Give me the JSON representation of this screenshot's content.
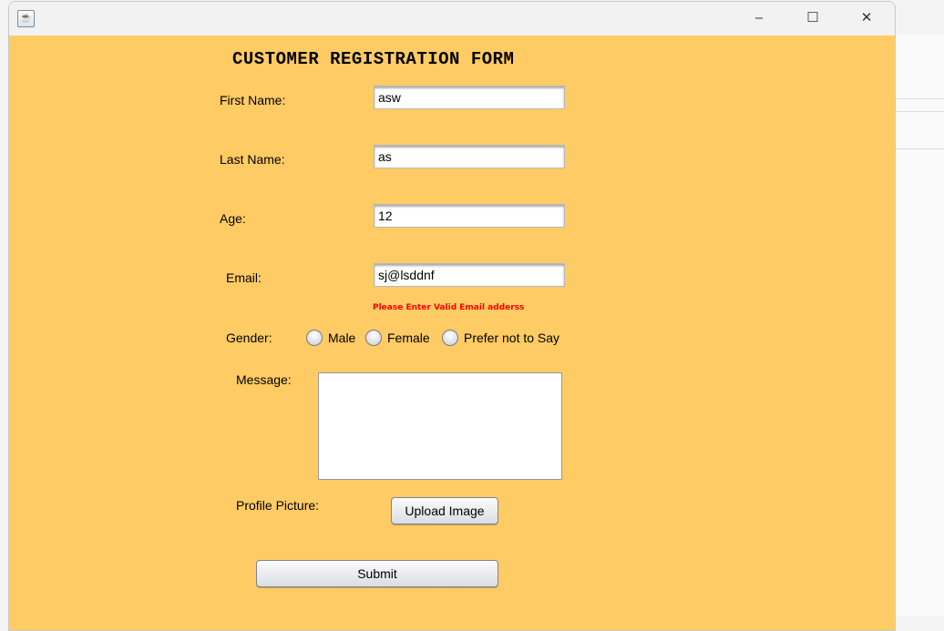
{
  "window": {
    "icon": "java-icon",
    "controls": {
      "minimize": "minimize-icon",
      "maximize": "maximize-icon",
      "close": "close-icon"
    }
  },
  "colors": {
    "background": "#ffcb64",
    "error": "#ff0000"
  },
  "form": {
    "title": "CUSTOMER REGISTRATION FORM",
    "first_name": {
      "label": "First Name:",
      "value": "asw"
    },
    "last_name": {
      "label": "Last Name:",
      "value": "as"
    },
    "age": {
      "label": "Age:",
      "value": "12"
    },
    "email": {
      "label": "Email:",
      "value": "sj@lsddnf",
      "error": "Please Enter Valid Email adderss"
    },
    "gender": {
      "label": "Gender:",
      "options": [
        "Male",
        "Female",
        "Prefer not to Say"
      ],
      "selected": null
    },
    "message": {
      "label": "Message:",
      "value": ""
    },
    "profile_picture": {
      "label": "Profile Picture:",
      "button": "Upload Image"
    },
    "submit": "Submit"
  }
}
